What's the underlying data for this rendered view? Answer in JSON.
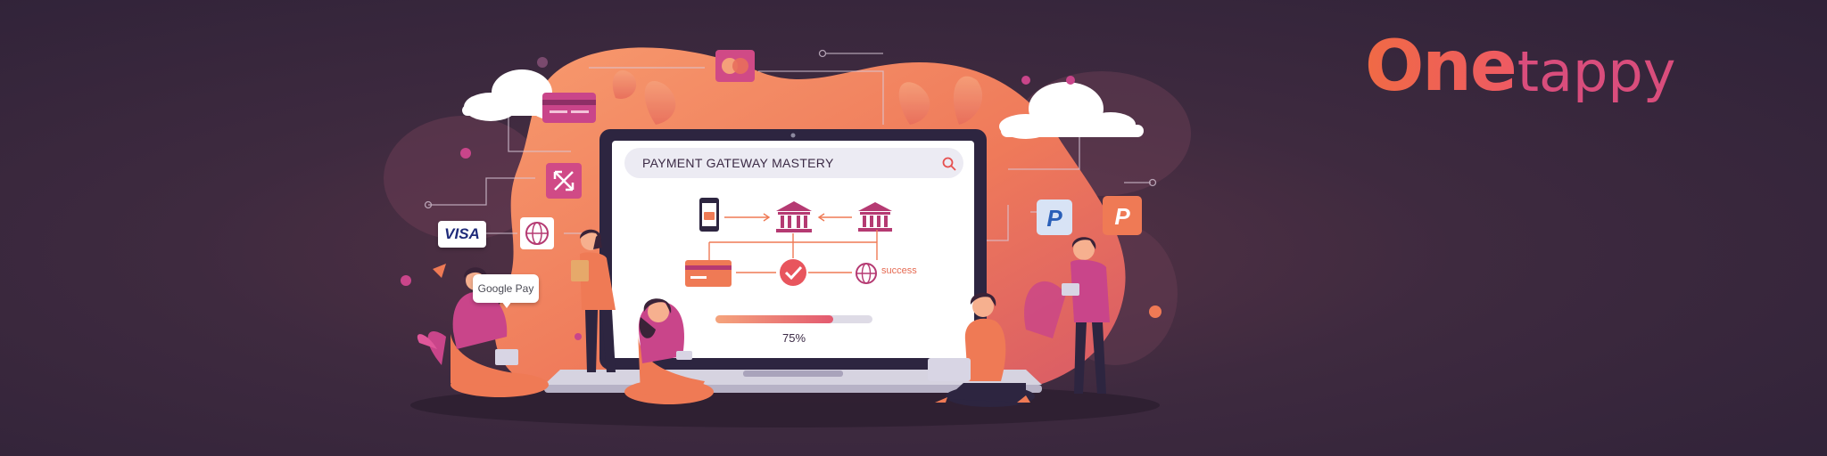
{
  "brand": {
    "part_one": "One",
    "part_two": "tappy"
  },
  "screen": {
    "title": "PAYMENT GATEWAY MASTERY",
    "success_label": "success",
    "progress": {
      "value": 0.75,
      "label": "75%"
    }
  },
  "payment_methods": {
    "visa_label": "VISA",
    "google_pay_label": "Google Pay"
  },
  "colors": {
    "background": "#3e2a3f",
    "accent_orange": "#f06a45",
    "accent_pink": "#d94d7c",
    "blob": "#f0805a",
    "screen": "#ffffff"
  },
  "icons": [
    "cloud-icon",
    "credit-card-icon",
    "mastercard-icon",
    "transfer-icon",
    "globe-icon",
    "phone-icon",
    "bank-icon",
    "checkmark-icon",
    "paypal-icon",
    "search-icon",
    "leaf-icon"
  ]
}
